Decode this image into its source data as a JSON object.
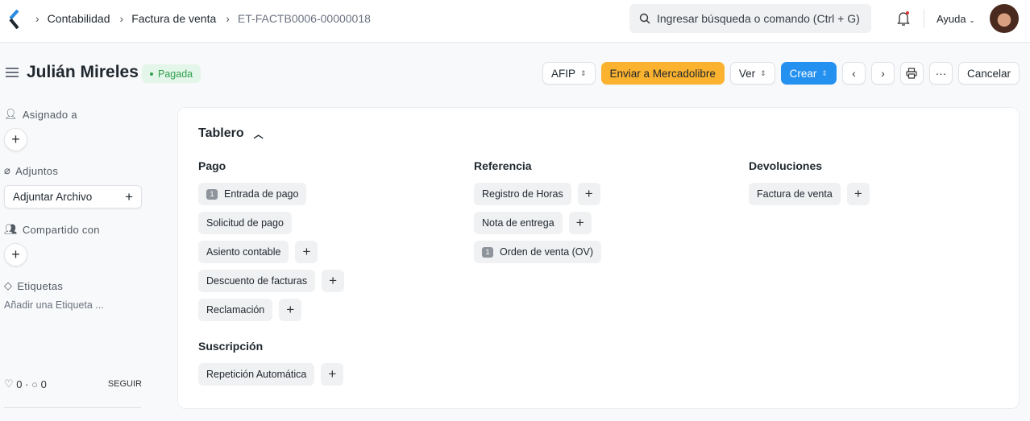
{
  "breadcrumbs": [
    "Contabilidad",
    "Factura de venta",
    "ET-FACTB0006-00000018"
  ],
  "search": {
    "placeholder": "Ingresar búsqueda o comando (Ctrl + G)"
  },
  "help": "Ayuda",
  "title": "Julián Mireles",
  "status": "Pagada",
  "actions": {
    "afip": "AFIP",
    "send": "Enviar a Mercadolibre",
    "view": "Ver",
    "create": "Crear",
    "cancel": "Cancelar",
    "more": "···"
  },
  "sidebar": {
    "assigned": "Asignado a",
    "attachments": "Adjuntos",
    "attach_button": "Adjuntar Archivo",
    "shared": "Compartido con",
    "tags": "Etiquetas",
    "add_tag": "Añadir una Etiqueta ...",
    "likes": "0",
    "comments": "0",
    "follow": "SEGUIR"
  },
  "dashboard": {
    "title": "Tablero",
    "pago": {
      "heading": "Pago",
      "items": [
        {
          "label": "Entrada de pago",
          "count": "1"
        },
        {
          "label": "Solicitud de pago"
        },
        {
          "label": "Asiento contable"
        },
        {
          "label": "Descuento de facturas"
        },
        {
          "label": "Reclamación"
        }
      ]
    },
    "referencia": {
      "heading": "Referencia",
      "items": [
        {
          "label": "Registro de Horas"
        },
        {
          "label": "Nota de entrega"
        },
        {
          "label": "Orden de venta (OV)",
          "count": "1"
        }
      ]
    },
    "devoluciones": {
      "heading": "Devoluciones",
      "items": [
        {
          "label": "Factura de venta"
        }
      ]
    },
    "suscripcion": {
      "heading": "Suscripción",
      "items": [
        {
          "label": "Repetición Automática"
        }
      ]
    }
  }
}
